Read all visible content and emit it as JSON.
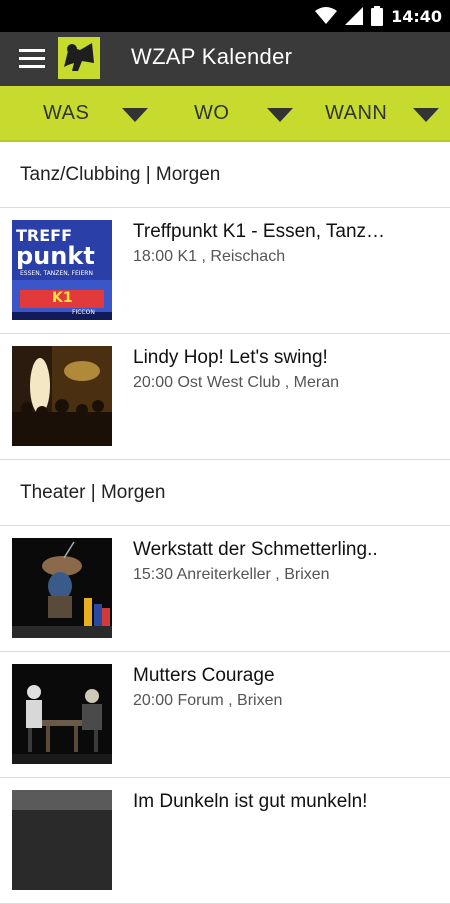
{
  "status": {
    "time": "14:40"
  },
  "app": {
    "title": "WZAP Kalender"
  },
  "filters": [
    {
      "label": "WAS"
    },
    {
      "label": "WO"
    },
    {
      "label": "WANN"
    }
  ],
  "sections": [
    {
      "header": "Tanz/Clubbing | Morgen",
      "events": [
        {
          "title": "Treffpunkt K1 - Essen, Tanz…",
          "subtitle": "18:00 K1 , Reischach",
          "thumb_text": [
            "TREFF",
            "punkt",
            "ESSEN, TANZEN, FEIERN",
            "K1",
            "FICCON"
          ]
        },
        {
          "title": "Lindy Hop! Let's swing!",
          "subtitle": "20:00 Ost West Club , Meran"
        }
      ]
    },
    {
      "header": "Theater | Morgen",
      "events": [
        {
          "title": "Werkstatt der Schmetterling..",
          "subtitle": "15:30 Anreiterkeller , Brixen"
        },
        {
          "title": "Mutters Courage",
          "subtitle": "20:00 Forum , Brixen"
        },
        {
          "title": "Im Dunkeln ist gut munkeln!",
          "subtitle": ""
        }
      ]
    }
  ],
  "colors": {
    "appbar": "#3a3a3a",
    "filterbar": "#c6db2e",
    "statusbar": "#000000"
  }
}
